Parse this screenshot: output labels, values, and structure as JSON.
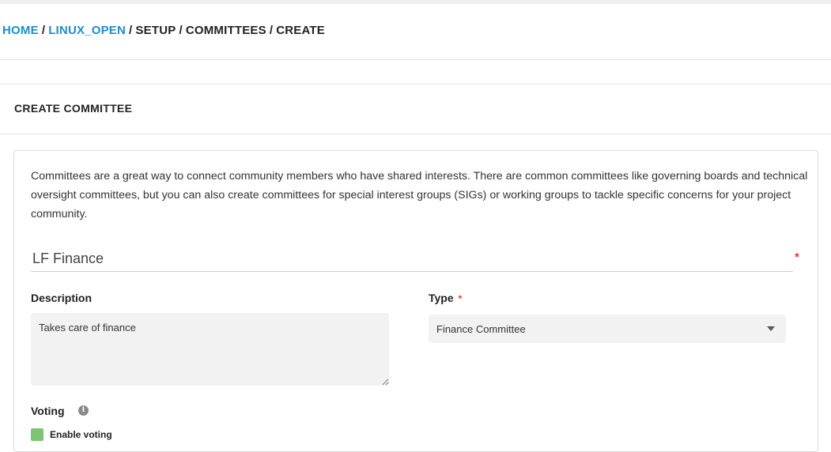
{
  "breadcrumb": {
    "home": "HOME",
    "project": "LINUX_OPEN",
    "setup": "SETUP",
    "committees": "COMMITTEES",
    "create": "CREATE",
    "separator": "/"
  },
  "section": {
    "title": "CREATE COMMITTEE"
  },
  "form": {
    "intro": "Committees are a great way to connect community members who have shared interests. There are common committees like governing boards and technical oversight committees, but you can also create committees for special interest groups (SIGs) or working groups to tackle specific concerns for your project community.",
    "name_value": "LF Finance",
    "required_mark": "*",
    "description_label": "Description",
    "description_value": "Takes care of finance",
    "type_label": "Type",
    "type_value": "Finance Committee",
    "voting_label": "Voting",
    "enable_voting_label": "Enable voting",
    "enable_voting_checked": true
  },
  "icons": {
    "info": "info-icon",
    "caret": "chevron-down-icon",
    "checkbox": "checkbox-checked-icon"
  },
  "colors": {
    "link": "#1b8fc6",
    "required": "#e53935",
    "checkbox": "#7cc576"
  }
}
